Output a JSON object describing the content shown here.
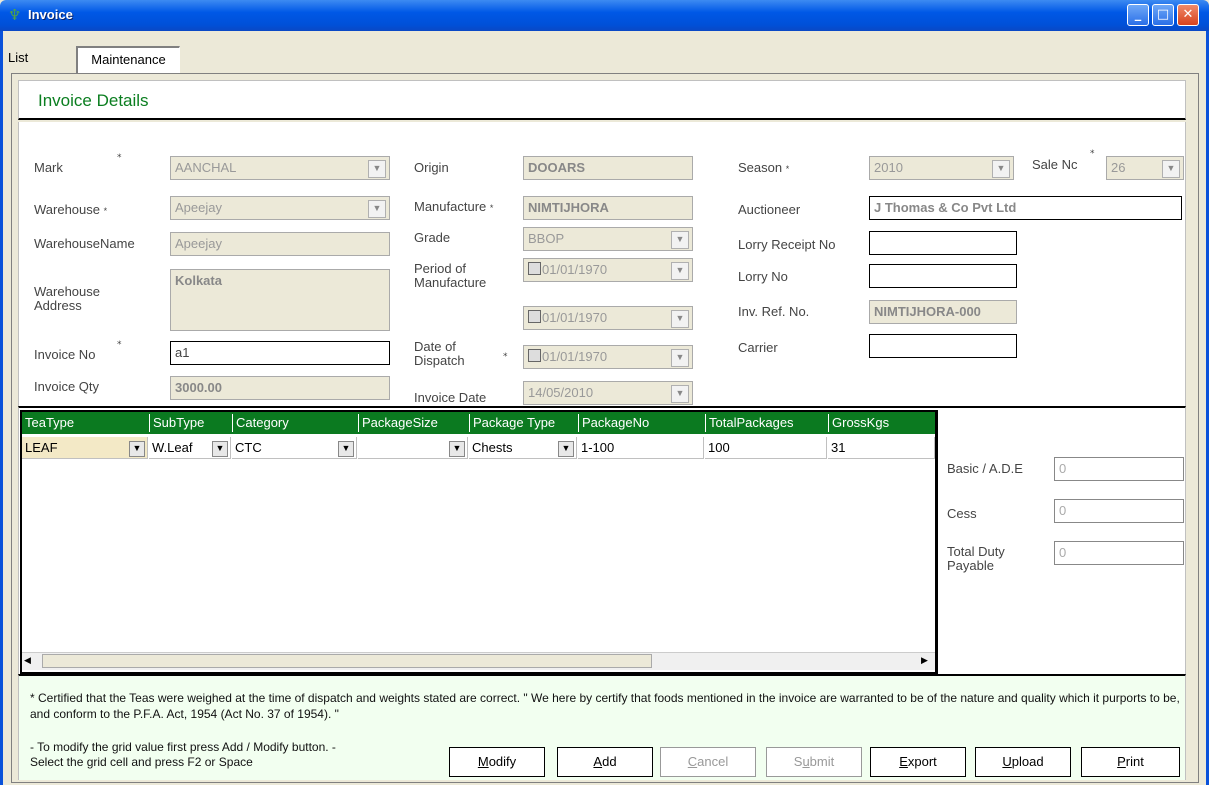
{
  "window": {
    "title": "Invoice"
  },
  "tabs": {
    "list": "List",
    "maintenance": "Maintenance"
  },
  "header": {
    "title": "Invoice Details"
  },
  "form": {
    "mark": {
      "label": "Mark",
      "value": "AANCHAL"
    },
    "warehouse": {
      "label": "Warehouse",
      "value": "Apeejay"
    },
    "warehouse_name": {
      "label": "WarehouseName",
      "value": "Apeejay"
    },
    "warehouse_address": {
      "label": "Warehouse Address",
      "value": "Kolkata"
    },
    "invoice_no": {
      "label": "Invoice No",
      "value": "a1"
    },
    "invoice_qty": {
      "label": "Invoice Qty",
      "value": "3000.00"
    },
    "origin": {
      "label": "Origin",
      "value": "DOOARS"
    },
    "manufacture": {
      "label": "Manufacture",
      "value": "NIMTIJHORA"
    },
    "grade": {
      "label": "Grade",
      "value": "BBOP"
    },
    "period_of_manufacture": {
      "label": "Period of Manufacture",
      "from": "01/01/1970",
      "to": "01/01/1970"
    },
    "date_of_dispatch": {
      "label": "Date of Dispatch",
      "value": "01/01/1970"
    },
    "invoice_date": {
      "label": "Invoice Date",
      "value": "14/05/2010"
    },
    "season": {
      "label": "Season",
      "value": "2010"
    },
    "sale_no": {
      "label": "Sale Nc",
      "value": "26"
    },
    "auctioneer": {
      "label": "Auctioneer",
      "value": "J Thomas & Co Pvt Ltd"
    },
    "lorry_receipt_no": {
      "label": "Lorry Receipt No",
      "value": ""
    },
    "lorry_no": {
      "label": "Lorry No",
      "value": ""
    },
    "inv_ref_no": {
      "label": "Inv. Ref. No.",
      "value": "NIMTIJHORA-000"
    },
    "carrier": {
      "label": "Carrier",
      "value": ""
    },
    "required_mark": "*"
  },
  "grid": {
    "columns": [
      "TeaType",
      "SubType",
      "Category",
      "PackageSize",
      "Package Type",
      "PackageNo",
      "TotalPackages",
      "GrossKgs"
    ],
    "rows": [
      [
        "LEAF",
        "W.Leaf",
        "CTC",
        "",
        "Chests",
        "1-100",
        "100",
        "31"
      ]
    ]
  },
  "duty": {
    "basic": {
      "label": "Basic / A.D.E",
      "value": "0"
    },
    "cess": {
      "label": "Cess",
      "value": "0"
    },
    "total": {
      "label": "Total Duty Payable",
      "value": "0"
    }
  },
  "footer": {
    "certificate": "* Certified that the Teas were weighed at the time of dispatch and weights stated are correct. \" We here by certify that foods mentioned in the invoice are warranted to be of the nature and quality which it purports to be, and conform to the P.F.A. Act, 1954 (Act No. 37 of 1954). \"",
    "help": "- To modify the grid value first press Add / Modify button. - Select the grid cell and  press F2 or Space"
  },
  "buttons": {
    "modify": "odify",
    "modify_key": "M",
    "add": "dd",
    "add_key": "A",
    "cancel": "ancel",
    "cancel_key": "C",
    "submit_pre": "S",
    "submit_key": "u",
    "submit": "bmit",
    "export": "xport",
    "export_key": "E",
    "upload": "pload",
    "upload_key": "U",
    "print": "rint",
    "print_key": "P"
  },
  "colors": {
    "accent_green": "#0b7a20",
    "title_bar": "#0058e6"
  }
}
